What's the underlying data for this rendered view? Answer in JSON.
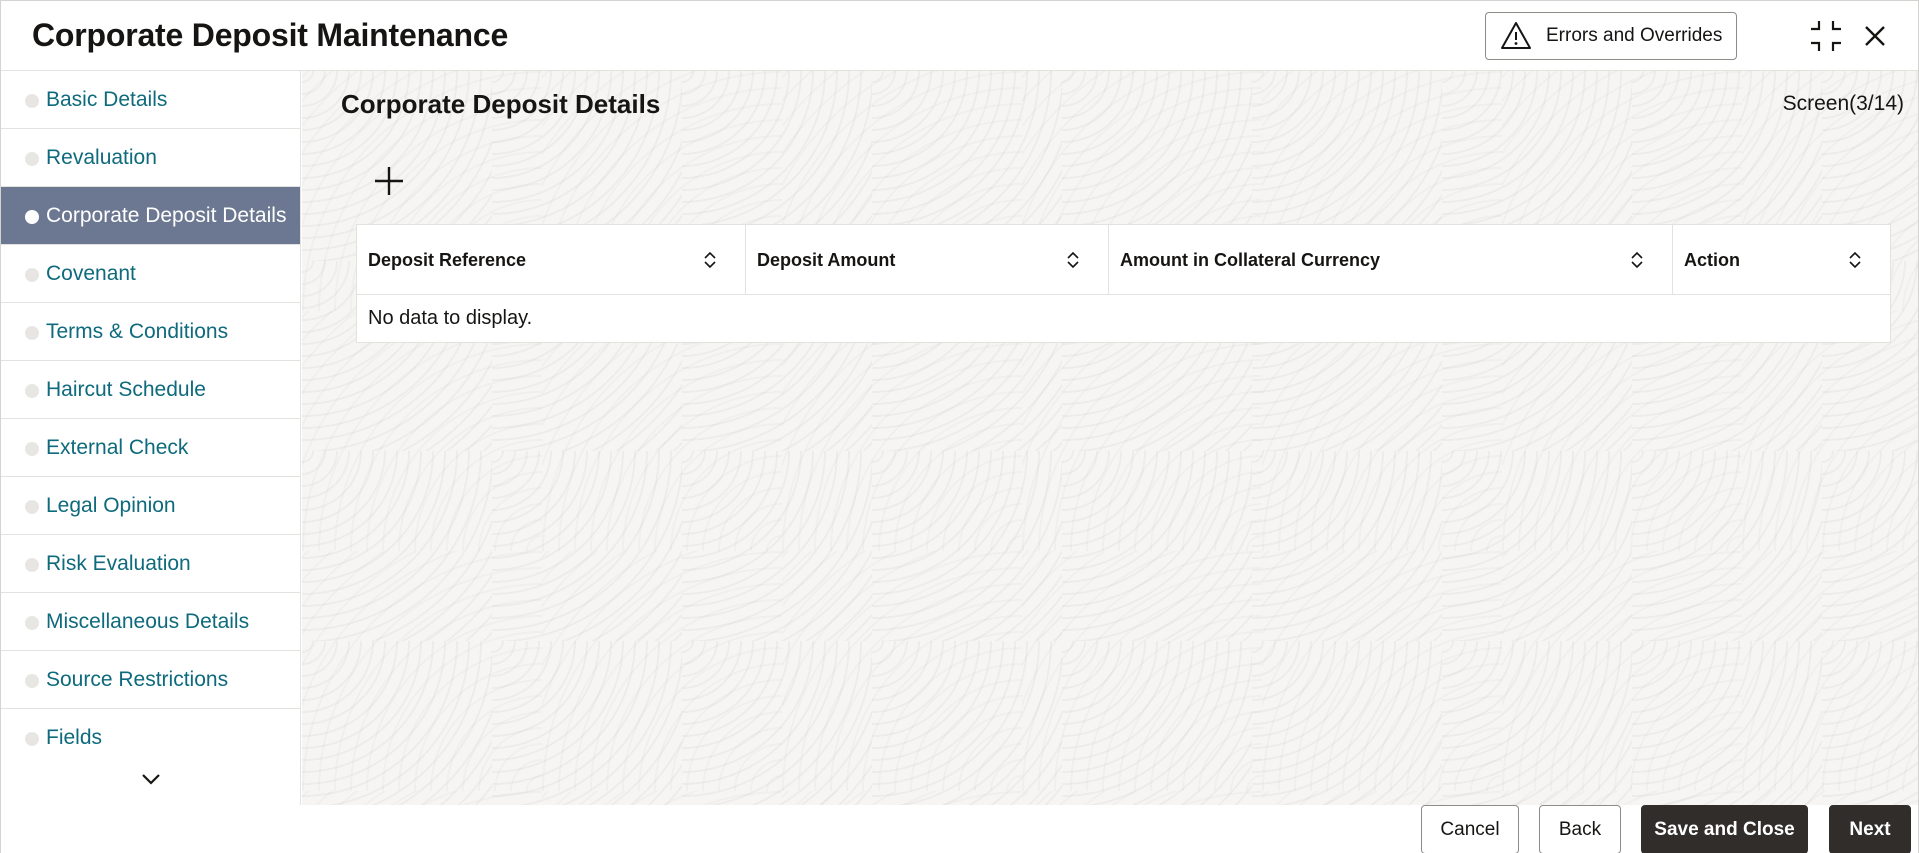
{
  "header": {
    "title": "Corporate Deposit Maintenance",
    "errors_button": "Errors and Overrides"
  },
  "sidebar": {
    "items": [
      {
        "label": "Basic Details",
        "active": false
      },
      {
        "label": "Revaluation",
        "active": false
      },
      {
        "label": "Corporate Deposit Details",
        "active": true
      },
      {
        "label": "Covenant",
        "active": false
      },
      {
        "label": "Terms & Conditions",
        "active": false
      },
      {
        "label": "Haircut Schedule",
        "active": false
      },
      {
        "label": "External Check",
        "active": false
      },
      {
        "label": "Legal Opinion",
        "active": false
      },
      {
        "label": "Risk Evaluation",
        "active": false
      },
      {
        "label": "Miscellaneous Details",
        "active": false
      },
      {
        "label": "Source Restrictions",
        "active": false
      },
      {
        "label": "Fields",
        "active": false
      }
    ]
  },
  "main": {
    "section_title": "Corporate Deposit Details",
    "screen_indicator": "Screen(3/14)",
    "table": {
      "columns": [
        "Deposit Reference",
        "Deposit Amount",
        "Amount in Collateral Currency",
        "Action"
      ],
      "empty_message": "No data to display."
    }
  },
  "footer": {
    "cancel": "Cancel",
    "back": "Back",
    "save_and_close": "Save and Close",
    "next": "Next"
  },
  "colors": {
    "nav_link": "#0e6a7c",
    "nav_active_bg": "#6c7891",
    "primary_button": "#312d2a"
  },
  "icons": {
    "warning": "warning-icon",
    "compress": "compress-icon",
    "close": "close-icon",
    "add": "add-icon",
    "sort": "sort-icon",
    "more": "chevron-down-icon"
  }
}
